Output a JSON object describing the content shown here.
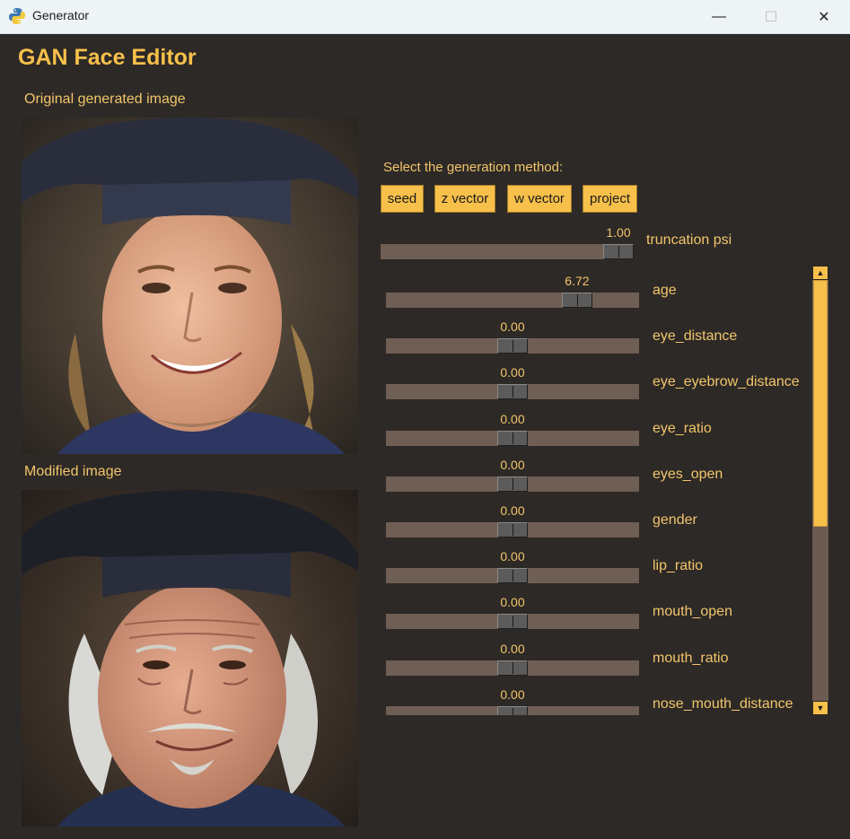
{
  "window": {
    "title": "Generator",
    "controls": {
      "minimize": "—",
      "maximize": "☐",
      "close": "✕"
    }
  },
  "app": {
    "title": "GAN Face Editor"
  },
  "images": {
    "original_label": "Original generated image",
    "modified_label": "Modified image"
  },
  "generation": {
    "label": "Select the generation method:",
    "buttons": [
      "seed",
      "z vector",
      "w vector",
      "project"
    ]
  },
  "truncation": {
    "name": "truncation psi",
    "value": "1.00",
    "fraction": 1.0
  },
  "sliders": [
    {
      "name": "age",
      "value": "6.72",
      "fraction": 0.79
    },
    {
      "name": "eye_distance",
      "value": "0.00",
      "fraction": 0.5
    },
    {
      "name": "eye_eyebrow_distance",
      "value": "0.00",
      "fraction": 0.5
    },
    {
      "name": "eye_ratio",
      "value": "0.00",
      "fraction": 0.5
    },
    {
      "name": "eyes_open",
      "value": "0.00",
      "fraction": 0.5
    },
    {
      "name": "gender",
      "value": "0.00",
      "fraction": 0.5
    },
    {
      "name": "lip_ratio",
      "value": "0.00",
      "fraction": 0.5
    },
    {
      "name": "mouth_open",
      "value": "0.00",
      "fraction": 0.5
    },
    {
      "name": "mouth_ratio",
      "value": "0.00",
      "fraction": 0.5
    },
    {
      "name": "nose_mouth_distance",
      "value": "0.00",
      "fraction": 0.5
    }
  ],
  "scroll": {
    "position": 0,
    "visible_fraction": 0.58
  },
  "colors": {
    "accent": "#f7c04a",
    "background": "#2d2926",
    "track": "#6e5e53"
  }
}
